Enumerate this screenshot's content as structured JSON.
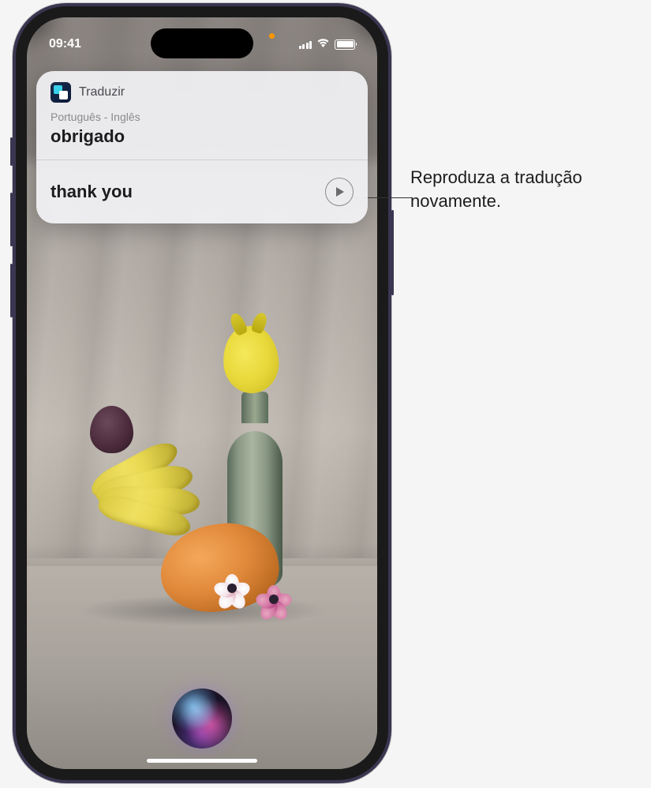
{
  "status": {
    "time": "09:41"
  },
  "translate_card": {
    "app_name": "Traduzir",
    "language_pair": "Português - Inglês",
    "source_text": "obrigado",
    "translated_text": "thank you"
  },
  "callout": {
    "text": "Reproduza a tradução novamente."
  }
}
